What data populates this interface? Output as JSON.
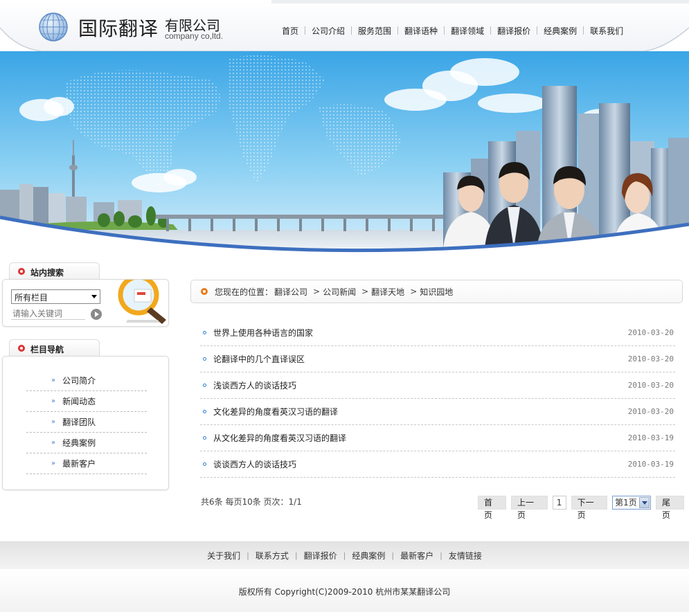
{
  "logo": {
    "cn_name": "国际翻译",
    "sub_name": "有限公司",
    "en_name": "company co,ltd."
  },
  "nav": {
    "items": [
      {
        "label": "首页"
      },
      {
        "label": "公司介绍"
      },
      {
        "label": "服务范围"
      },
      {
        "label": "翻译语种"
      },
      {
        "label": "翻译领域"
      },
      {
        "label": "翻译报价"
      },
      {
        "label": "经典案例"
      },
      {
        "label": "联系我们"
      }
    ]
  },
  "search": {
    "title": "站内搜索",
    "category_selected": "所有栏目",
    "keyword_placeholder": "请输入关键词"
  },
  "column_nav": {
    "title": "栏目导航",
    "items": [
      {
        "label": "公司简介"
      },
      {
        "label": "新闻动态"
      },
      {
        "label": "翻译团队"
      },
      {
        "label": "经典案例"
      },
      {
        "label": "最新客户"
      }
    ]
  },
  "breadcrumb": {
    "prefix": "您现在的位置：",
    "items": [
      {
        "label": "翻译公司"
      },
      {
        "label": "公司新闻"
      },
      {
        "label": "翻译天地"
      },
      {
        "label": "知识园地"
      }
    ],
    "separator": ">"
  },
  "articles": [
    {
      "title": "世界上使用各种语言的国家",
      "date": "2010-03-20"
    },
    {
      "title": "论翻译中的几个直译误区",
      "date": "2010-03-20"
    },
    {
      "title": "浅谈西方人的谈话技巧",
      "date": "2010-03-20"
    },
    {
      "title": "文化差异的角度看英汉习语的翻译",
      "date": "2010-03-20"
    },
    {
      "title": "从文化差异的角度看英汉习语的翻译",
      "date": "2010-03-19"
    },
    {
      "title": "谈谈西方人的谈话技巧",
      "date": "2010-03-19"
    }
  ],
  "pagination": {
    "info": "共6条  每页10条  页次：1/1",
    "first": "首页",
    "prev": "上一页",
    "current": "1",
    "next": "下一页",
    "page_select": "第1页",
    "last": "尾页"
  },
  "footer": {
    "links": [
      {
        "label": "关于我们"
      },
      {
        "label": "联系方式"
      },
      {
        "label": "翻译报价"
      },
      {
        "label": "经典案例"
      },
      {
        "label": "最新客户"
      },
      {
        "label": "友情链接"
      }
    ],
    "separator": "|",
    "copyright": "版权所有  Copyright(C)2009-2010 杭州市某某翻译公司"
  },
  "colors": {
    "accent_blue": "#2e7fd1",
    "search_dot_red": "#d33333",
    "crumb_dot_orange": "#e87b1c",
    "banner_sky": "#4fb2ea",
    "banner_curve": "#3d6fbf"
  },
  "icons": {
    "logo": "globe-icon",
    "search_go": "arrow-right-circle-icon",
    "search_decoration": "magnifier-icon",
    "column_nav_item": "double-chevron-right-icon",
    "article_bullet": "circle-bullet-icon"
  }
}
